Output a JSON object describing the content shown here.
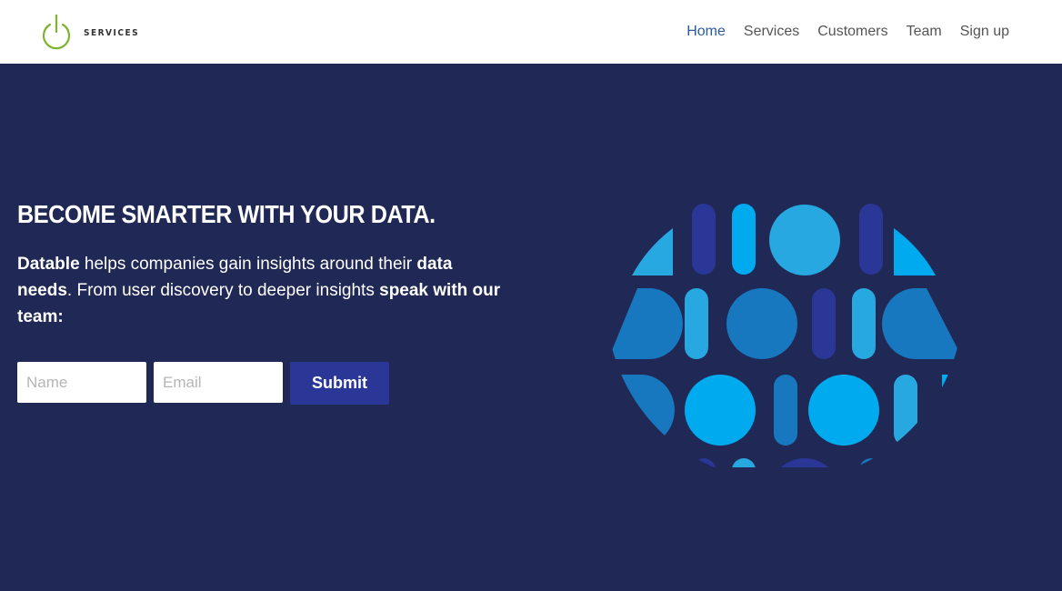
{
  "brand": {
    "logo_text": "SERVICES",
    "logo_color": "#7cb42c"
  },
  "nav": {
    "items": [
      {
        "label": "Home",
        "active": true
      },
      {
        "label": "Services",
        "active": false
      },
      {
        "label": "Customers",
        "active": false
      },
      {
        "label": "Team",
        "active": false
      },
      {
        "label": "Sign up",
        "active": false
      }
    ]
  },
  "hero": {
    "headline": "BECOME SMARTER WITH YOUR DATA.",
    "lede": {
      "p1": "Datable",
      "p2": " helps companies gain insights around their ",
      "p3": "data needs",
      "p4": ". From user discovery to deeper insights ",
      "p5": "speak with our team:"
    },
    "background": "#202856"
  },
  "form": {
    "name_placeholder": "Name",
    "email_placeholder": "Email",
    "submit_label": "Submit"
  },
  "colors": {
    "nav_active": "#2b5b9e",
    "button": "#2a3796",
    "globe_light": "#27a8e0",
    "globe_mid": "#1777bf",
    "globe_bright": "#00aaee",
    "globe_dark": "#2a3796"
  }
}
